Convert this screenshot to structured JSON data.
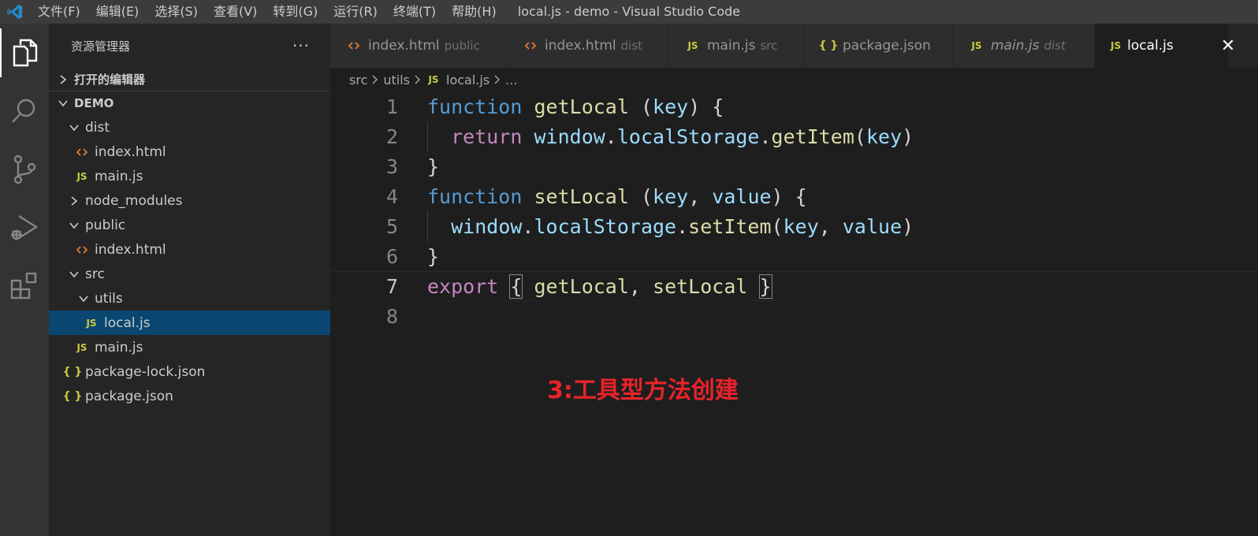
{
  "window": {
    "title": "local.js - demo - Visual Studio Code",
    "menu": [
      "文件(F)",
      "编辑(E)",
      "选择(S)",
      "查看(V)",
      "转到(G)",
      "运行(R)",
      "终端(T)",
      "帮助(H)"
    ]
  },
  "sidebar": {
    "title": "资源管理器",
    "more": "···",
    "open_editors": "打开的编辑器",
    "workspace": "DEMO",
    "tree": [
      {
        "label": "dist",
        "type": "folder",
        "expanded": true
      },
      {
        "label": "index.html",
        "type": "html"
      },
      {
        "label": "main.js",
        "type": "js",
        "icon": "JS"
      },
      {
        "label": "node_modules",
        "type": "folder",
        "expanded": false
      },
      {
        "label": "public",
        "type": "folder",
        "expanded": true
      },
      {
        "label": "index.html",
        "type": "html"
      },
      {
        "label": "src",
        "type": "folder",
        "expanded": true
      },
      {
        "label": "utils",
        "type": "folder",
        "expanded": true
      },
      {
        "label": "local.js",
        "type": "js",
        "icon": "JS",
        "selected": true
      },
      {
        "label": "main.js",
        "type": "js",
        "icon": "JS"
      },
      {
        "label": "package-lock.json",
        "type": "json",
        "icon": "{ }"
      },
      {
        "label": "package.json",
        "type": "json",
        "icon": "{ }"
      }
    ]
  },
  "tabs": [
    {
      "label": "index.html",
      "desc": "public",
      "icon": "<>"
    },
    {
      "label": "index.html",
      "desc": "dist",
      "icon": "<>"
    },
    {
      "label": "main.js",
      "desc": "src",
      "icon": "JS"
    },
    {
      "label": "package.json",
      "desc": "",
      "icon": "{ }"
    },
    {
      "label": "main.js",
      "desc": "dist",
      "icon": "JS",
      "italic": true
    },
    {
      "label": "local.js",
      "desc": "",
      "icon": "JS",
      "active": true,
      "close": "✕"
    }
  ],
  "breadcrumb": {
    "parts": [
      "src",
      "utils"
    ],
    "file_icon": "JS",
    "file": "local.js",
    "tail": "..."
  },
  "editor": {
    "line_numbers": [
      "1",
      "2",
      "3",
      "4",
      "5",
      "6",
      "7",
      "8"
    ],
    "current_line": "7"
  },
  "annotation": "3:工具型方法创建",
  "colors": {
    "accent_selection": "#094771",
    "annotation": "#e8232a",
    "keyword": "#569cd6",
    "function": "#dcdcaa",
    "variable": "#9cdcfe"
  }
}
